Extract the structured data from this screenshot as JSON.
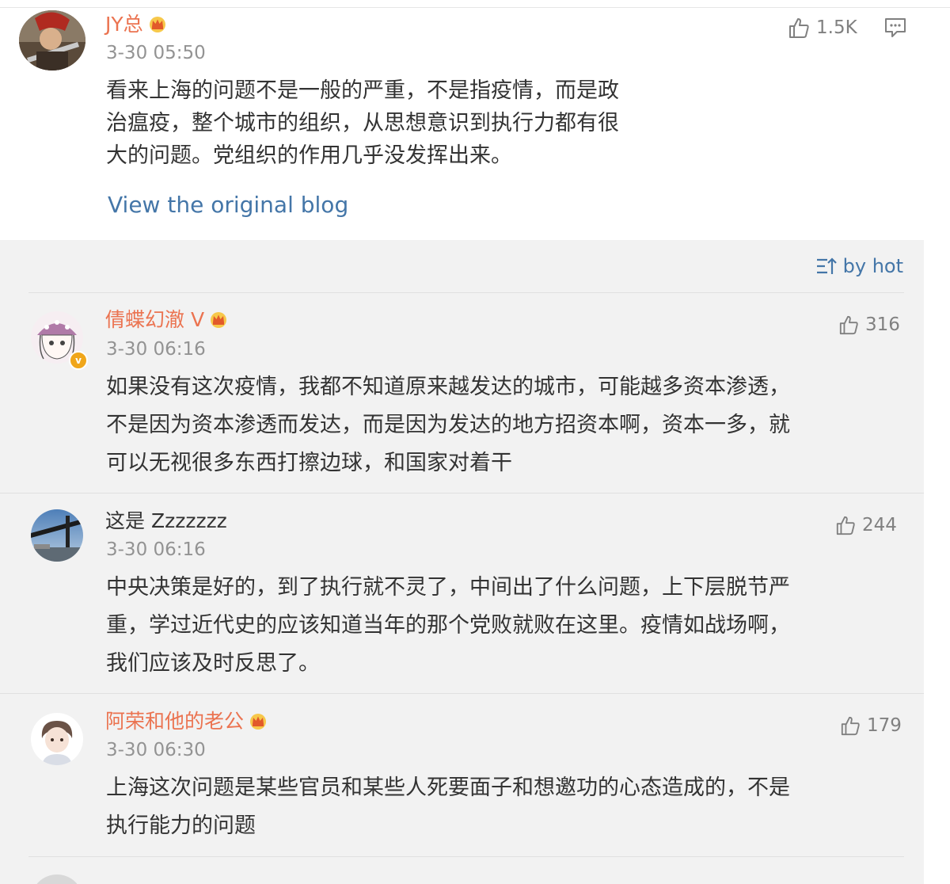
{
  "post": {
    "username": "JY总",
    "time": "3-30 05:50",
    "text_lines": [
      "看来上海的问题不是一般的严重，不是指疫情，而是政",
      "治瘟疫，整个城市的组织，从思想意识到执行力都有很",
      "大的问题。党组织的作用几乎没发挥出来。"
    ],
    "likes": "1.5K",
    "view_original": "View the original blog"
  },
  "sort": {
    "label": "by hot"
  },
  "comments": [
    {
      "username": "倩蝶幻澈 V",
      "time": "3-30 06:16",
      "likes": "316",
      "text_lines": [
        "如果没有这次疫情，我都不知道原来越发达的城市，可能越多资本渗透，",
        "不是因为资本渗透而发达，而是因为发达的地方招资本啊，资本一多，就",
        "可以无视很多东西打擦边球，和国家对着干"
      ]
    },
    {
      "username": "这是 Zzzzzzz",
      "time": "3-30 06:16",
      "likes": "244",
      "text_lines": [
        "中央决策是好的，到了执行就不灵了，中间出了什么问题，上下层脱节严",
        "重，学过近代史的应该知道当年的那个党败就败在这里。疫情如战场啊，",
        "我们应该及时反思了。"
      ]
    },
    {
      "username": "阿荣和他的老公",
      "time": "3-30 06:30",
      "likes": "179",
      "text_lines": [
        "上海这次问题是某些官员和某些人死要面子和想邀功的心态造成的，不是",
        "执行能力的问题"
      ]
    }
  ],
  "colors": {
    "username_orange": "#eb7350",
    "link_blue": "#4476a8",
    "panel_bg": "#f2f2f2",
    "crown_gold": "#f0a61a"
  },
  "icons": [
    "thumbs-up-icon",
    "comment-icon",
    "sort-icon",
    "crown-icon",
    "verified-v-icon"
  ]
}
